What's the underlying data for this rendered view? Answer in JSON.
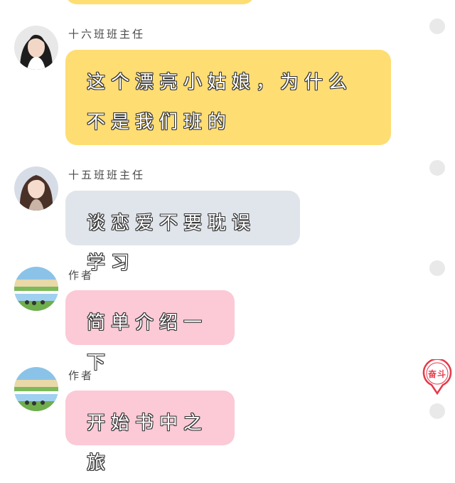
{
  "messages": [
    {
      "sender": "十六班班主任",
      "text": "这个漂亮小姑娘，为什么不是我们班的"
    },
    {
      "sender": "十五班班主任",
      "text": "谈恋爱不要耽误学习"
    },
    {
      "sender": "作者",
      "text": "简单介绍一下"
    },
    {
      "sender": "作者",
      "text": "开始书中之旅"
    }
  ],
  "badge": {
    "label": "奋斗"
  },
  "colors": {
    "yellow_bubble": "#fedd73",
    "gray_bubble": "#e0e5ec",
    "pink_bubble": "#fcc9d6",
    "badge_red": "#e6394a"
  }
}
